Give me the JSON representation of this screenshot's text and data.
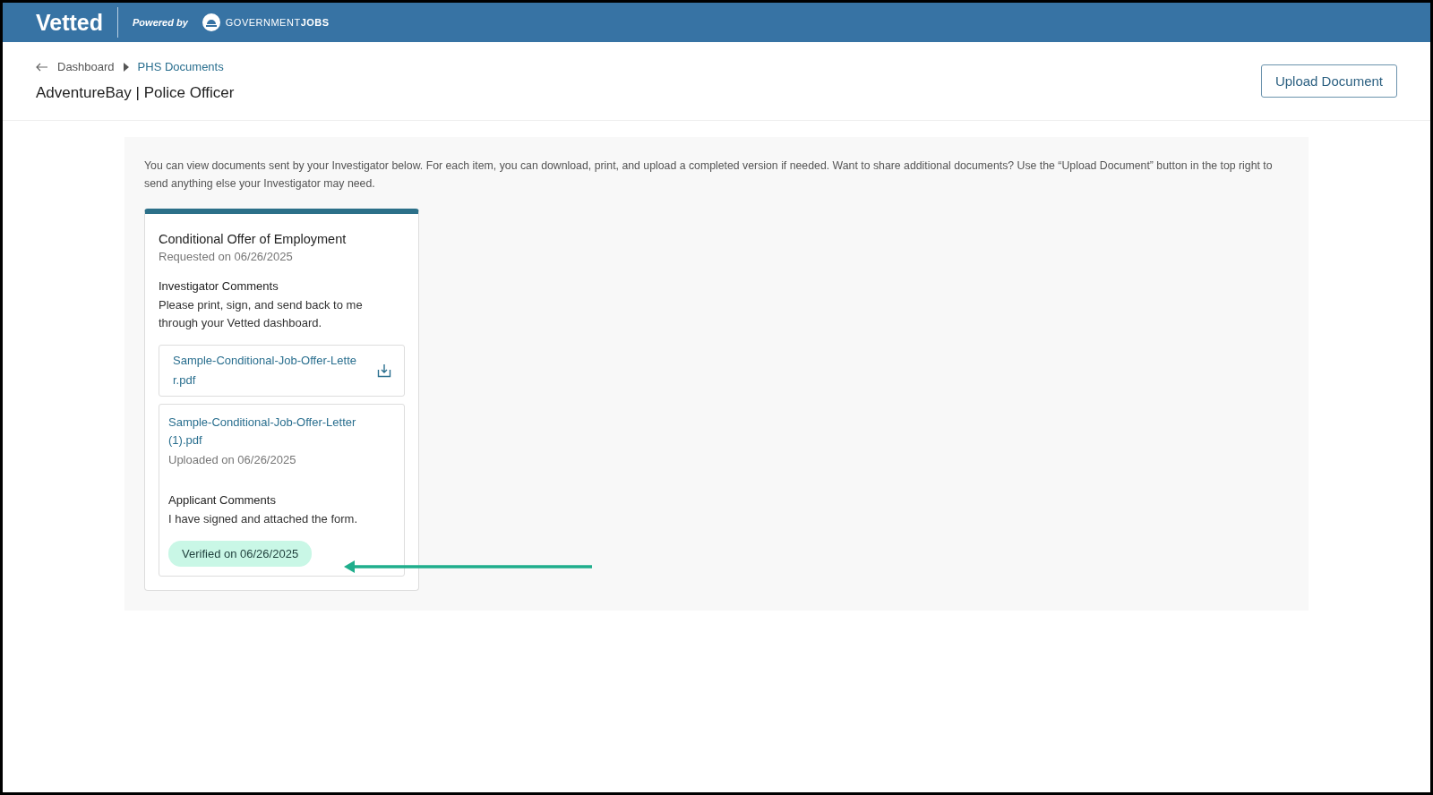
{
  "header": {
    "logo": "Vetted",
    "powered_by": "Powered by",
    "partner": "GOVERNMENT**JOBS**"
  },
  "breadcrumb": [
    {
      "label": "Dashboard",
      "current": false
    },
    {
      "label": "PHS Documents",
      "current": true
    }
  ],
  "page_title": "AdventureBay | Police Officer",
  "upload_button": "Upload Document",
  "intro": "You can view documents sent by your Investigator below. For each item, you can download, print, and upload a completed version if needed. Want to share additional documents? Use the “Upload Document” button in the top right to send anything else your Investigator may need.",
  "documents": [
    {
      "title": "Conditional Offer of Employment",
      "requested": "Requested on 06/26/2025",
      "comments_heading": "Investigator Comments",
      "comments": "Please print, sign, and send back to me through your Vetted dashboard.",
      "request_file": "Sample-Conditional-Job-Offer-Letter.pdf",
      "upload": {
        "file": "Sample-Conditional-Job-Offer-Letter (1).pdf",
        "uploaded": "Uploaded on 06/26/2025",
        "comments_heading": "Applicant Comments",
        "comments": "I have signed and attached the form.",
        "status": "Verified on 06/26/2025",
        "verified": true
      }
    }
  ]
}
